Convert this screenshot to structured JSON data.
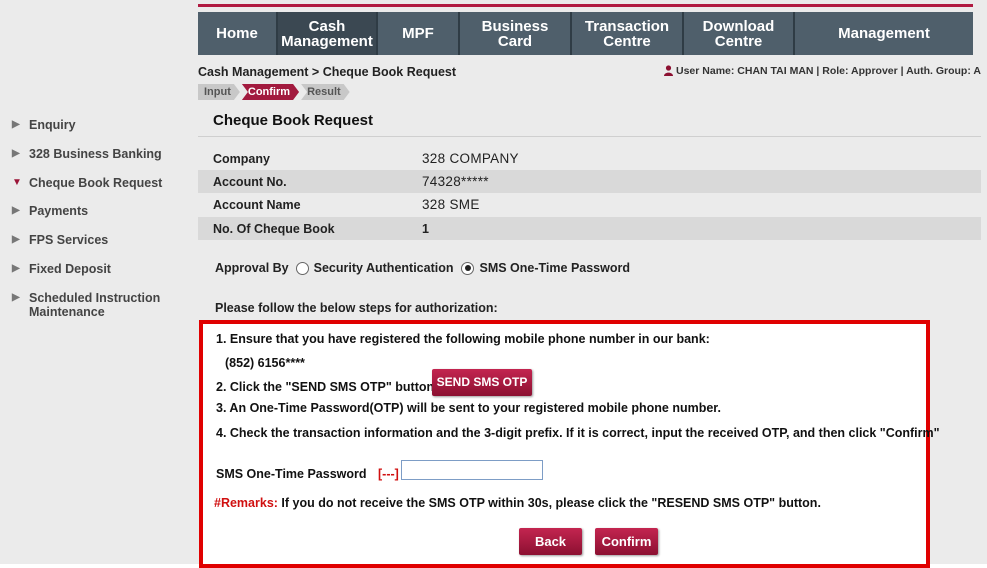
{
  "sidebar": {
    "items": [
      {
        "label": "Enquiry",
        "expanded": false
      },
      {
        "label": "328 Business Banking",
        "expanded": false
      },
      {
        "label": "Cheque Book Request",
        "expanded": true
      },
      {
        "label": "Payments",
        "expanded": false
      },
      {
        "label": "FPS Services",
        "expanded": false
      },
      {
        "label": "Fixed Deposit",
        "expanded": false
      },
      {
        "label": "Scheduled Instruction\nMaintenance",
        "expanded": false
      }
    ]
  },
  "nav": {
    "items": [
      {
        "label": "Home"
      },
      {
        "label": "Cash\nManagement"
      },
      {
        "label": "MPF"
      },
      {
        "label": "Business\nCard"
      },
      {
        "label": "Transaction\nCentre"
      },
      {
        "label": "Download\nCentre"
      },
      {
        "label": "Management"
      }
    ],
    "active_index": 1
  },
  "breadcrumb": "Cash Management > Cheque Book Request",
  "user_info": "User Name: CHAN TAI MAN | Role: Approver | Auth. Group: A",
  "steps": [
    "Input",
    "Confirm",
    "Result"
  ],
  "active_step": "Confirm",
  "page_title": "Cheque Book Request",
  "details": [
    {
      "label": "Company",
      "value": "328 COMPANY"
    },
    {
      "label": "Account No.",
      "value": "74328*****"
    },
    {
      "label": "Account Name",
      "value": "328 SME"
    },
    {
      "label": "No. Of Cheque Book",
      "value": "1"
    }
  ],
  "approval": {
    "label": "Approval By",
    "options": [
      "Security Authentication",
      "SMS One-Time Password"
    ],
    "selected": "SMS One-Time Password"
  },
  "instructions_title": "Please follow the below steps for authorization:",
  "auth": {
    "step1": "1. Ensure that you have registered the following mobile phone number in our bank:",
    "phone": "(852) 6156****",
    "step2": "2. Click the \"SEND SMS OTP\" button",
    "send_otp_label": "SEND SMS OTP",
    "step3": "3. An One-Time Password(OTP) will be sent to your registered mobile phone number.",
    "step4": "4. Check the transaction information and the 3-digit prefix. If it is correct, input the received OTP, and then click \"Confirm\"",
    "otp_label": "SMS One-Time Password",
    "otp_prefix": "[---]",
    "otp_value": "",
    "remarks_label": "#Remarks:",
    "remarks_text": " If you do not receive the SMS OTP within 30s, please click the \"RESEND SMS OTP\" button.",
    "back_label": "Back",
    "confirm_label": "Confirm"
  },
  "colors": {
    "brand": "#a21a3e",
    "nav_bg": "#4f5f6b",
    "highlight_border": "#e00000",
    "sidebar_bg": "#ebebeb"
  }
}
